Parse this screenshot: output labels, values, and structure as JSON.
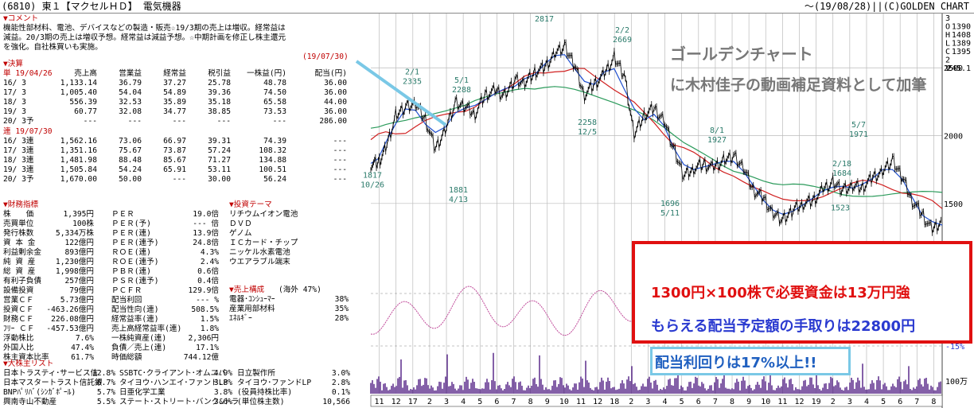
{
  "header": {
    "left": "(6810) 東１【マクセルＨＤ】 電気機器",
    "right": "～(19/08/28)||(C)GOLDEN CHART"
  },
  "comment": {
    "title": "▼コメント",
    "lines": [
      "機能性部材料、電池、デバイスなどの製造・販売☆19/3期の売上は増収。経常益は",
      "減益。20/3期の売上は増収予想。経常益は減益予想。☆中期計画を修正し株主還元",
      "を強化。自社株買いも実施。"
    ],
    "date": "(19/07/30)"
  },
  "kessan": {
    "title": "▼決算",
    "header": [
      "単 19/04/26",
      "売上高",
      "営業益",
      "経常益",
      "税引益",
      "一株益(円)",
      "配当(円)"
    ],
    "rows": [
      [
        "16/ 3",
        "1,133.14",
        "36.79",
        "37.27",
        "25.78",
        "48.78",
        "36.00"
      ],
      [
        "17/ 3",
        "1,005.40",
        "54.04",
        "54.89",
        "39.36",
        "74.50",
        "36.00"
      ],
      [
        "18/ 3",
        "556.39",
        "32.53",
        "35.89",
        "35.18",
        "65.58",
        "44.00"
      ],
      [
        "19/ 3",
        "60.77",
        "32.08",
        "34.77",
        "38.85",
        "73.53",
        "36.00"
      ],
      [
        "20/ 3予",
        "---",
        "---",
        "---",
        "---",
        "---",
        "286.00"
      ]
    ],
    "ren_header": "連 19/07/30",
    "ren_rows": [
      [
        "16/ 3連",
        "1,562.16",
        "73.06",
        "66.97",
        "39.31",
        "74.39",
        "---"
      ],
      [
        "17/ 3連",
        "1,351.16",
        "75.67",
        "73.87",
        "57.24",
        "108.32",
        "---"
      ],
      [
        "18/ 3連",
        "1,481.98",
        "88.48",
        "85.67",
        "71.27",
        "134.88",
        "---"
      ],
      [
        "19/ 3連",
        "1,505.84",
        "54.24",
        "65.91",
        "53.11",
        "100.51",
        "---"
      ],
      [
        "20/ 3予",
        "1,670.00",
        "50.00",
        "---",
        "30.00",
        "56.24",
        "---"
      ]
    ]
  },
  "zaimu": {
    "title": "▼財務指標",
    "rows": [
      [
        "株　　価",
        "1,395円",
        "ＰＥＲ",
        "19.0倍"
      ],
      [
        "売買単位",
        "100株",
        "ＰＥＲ(予)",
        "--- 倍"
      ],
      [
        "発行株数",
        "5,334万株",
        "ＰＥＲ(連)",
        "13.9倍"
      ],
      [
        "資 本 金",
        "122億円",
        "ＰＥＲ(連予)",
        "24.8倍"
      ],
      [
        "利益剰余金",
        "893億円",
        "ＲＯＥ(連)",
        "4.3%"
      ],
      [
        "純 資 産",
        "1,230億円",
        "ＲＯＥ(連予)",
        "2.4%"
      ],
      [
        "総 資 産",
        "1,998億円",
        "ＰＢＲ(連)",
        "0.6倍"
      ],
      [
        "有利子負債",
        "257億円",
        "ＰＳＲ(連予)",
        "0.4倍"
      ],
      [
        "設備投資",
        "79億円",
        "ＰＣＦＲ",
        "129.9倍"
      ],
      [
        "営業ＣＦ",
        "5.73億円",
        "配当利回",
        "--- %"
      ],
      [
        "投資ＣＦ",
        "-463.26億円",
        "配当性向(連)",
        "508.5%"
      ],
      [
        "財務ＣＦ",
        "226.08億円",
        "経常益率(連)",
        "1.5%"
      ],
      [
        "ﾌﾘｰ ＣＦ",
        "-457.53億円",
        "売上高経常益率(連)",
        "1.8%"
      ],
      [
        "浮動株比",
        "7.6%",
        "一株純資産(連)",
        "2,306円"
      ],
      [
        "外国人比",
        "47.4%",
        "負債／売上(連)",
        "17.1%"
      ],
      [
        "株主資本比率",
        "61.7%",
        "時価総額",
        "744.12億"
      ]
    ]
  },
  "theme": {
    "title": "▼投資テーマ",
    "items": [
      "リチウムイオン電池",
      "ＤＶＤ",
      "ゲノム",
      "ＩＣカード・チップ",
      "ニッケル水素電池",
      "ウエアラブル端末"
    ]
  },
  "kosei": {
    "title": "▼売上構成",
    "sub": "(海外 47%)",
    "rows": [
      [
        "電器･ｺﾝｼｭｰﾏｰ",
        "38%"
      ],
      [
        "産業用部材料",
        "35%"
      ],
      [
        "ｴﾈﾙｷﾞｰ",
        "28%"
      ]
    ]
  },
  "kabunushi": {
    "title": "▼大株主リスト",
    "rows": [
      [
        "日本トラスティ･サービス信",
        "12.8%",
        "SSBTC･クライアント･オムニバ",
        "4.9%",
        "日立製作所",
        "3.0%"
      ],
      [
        "日本マスタートラスト信託銀",
        "6.7%",
        "タイヨウ･ハンエイ･ファンドLP",
        "3.8%",
        "タイヨウ･ファンドLP",
        "2.8%"
      ],
      [
        "BNPﾊﾟﾘﾊﾞ(ｼﾝｶﾞﾎﾟｰﾙ)",
        "5.7%",
        "日亜化学工業",
        "3.8%",
        "(役員持株比率)",
        "0.1%"
      ],
      [
        "興南寺山不動産",
        "5.5%",
        "ステート･ストリート･バンク&トラ",
        "3.6%",
        "(単位株主数)",
        "10,566"
      ]
    ]
  },
  "ohlc": {
    "o": "O",
    "h": "H",
    "l": "L",
    "c": "C",
    "ov": "1390",
    "hv": "1408",
    "lv": "1389",
    "cv": "1395",
    "vlabel": "V",
    "vv": "245.1",
    "i1": "3",
    "i2": "2"
  },
  "chart_data": {
    "type": "line",
    "title": "",
    "y_ticks": [
      2500,
      2000,
      1500
    ],
    "ylim": [
      1200,
      2900
    ],
    "osc_labels": [
      "15%",
      "CY",
      "-15%"
    ],
    "vol_label": "100万",
    "x_labels": [
      "11",
      "12",
      "17",
      "2",
      "3",
      "4",
      "5",
      "6",
      "7",
      "8",
      "9",
      "10",
      "11",
      "12",
      "18",
      "2",
      "3",
      "4",
      "5",
      "6",
      "7",
      "8",
      "9",
      "10",
      "11",
      "12",
      "19",
      "2",
      "3",
      "4",
      "5",
      "6",
      "7",
      "8"
    ],
    "price_series": [
      [
        0,
        1790
      ],
      [
        3,
        1800
      ],
      [
        6,
        1900
      ],
      [
        10,
        2150
      ],
      [
        14,
        2210
      ],
      [
        18,
        2230
      ],
      [
        22,
        2120
      ],
      [
        26,
        1900
      ],
      [
        30,
        2050
      ],
      [
        34,
        2240
      ],
      [
        38,
        2210
      ],
      [
        42,
        2160
      ],
      [
        46,
        2300
      ],
      [
        50,
        2330
      ],
      [
        54,
        2300
      ],
      [
        58,
        2410
      ],
      [
        62,
        2380
      ],
      [
        66,
        2470
      ],
      [
        70,
        2500
      ],
      [
        74,
        2610
      ],
      [
        78,
        2660
      ],
      [
        82,
        2520
      ],
      [
        86,
        2300
      ],
      [
        90,
        2380
      ],
      [
        94,
        2450
      ],
      [
        98,
        2580
      ],
      [
        102,
        2450
      ],
      [
        106,
        2000
      ],
      [
        110,
        2150
      ],
      [
        114,
        2200
      ],
      [
        118,
        2120
      ],
      [
        122,
        1900
      ],
      [
        126,
        1700
      ],
      [
        130,
        1760
      ],
      [
        134,
        1790
      ],
      [
        138,
        1760
      ],
      [
        142,
        1820
      ],
      [
        146,
        1850
      ],
      [
        150,
        1760
      ],
      [
        154,
        1600
      ],
      [
        158,
        1540
      ],
      [
        162,
        1430
      ],
      [
        166,
        1380
      ],
      [
        170,
        1450
      ],
      [
        174,
        1500
      ],
      [
        178,
        1520
      ],
      [
        182,
        1600
      ],
      [
        186,
        1660
      ],
      [
        190,
        1600
      ],
      [
        194,
        1620
      ],
      [
        198,
        1620
      ],
      [
        202,
        1690
      ],
      [
        206,
        1740
      ],
      [
        210,
        1820
      ],
      [
        214,
        1690
      ],
      [
        218,
        1520
      ],
      [
        222,
        1420
      ],
      [
        226,
        1300
      ],
      [
        230,
        1380
      ]
    ],
    "peaks": [
      {
        "d": "2/1",
        "v": "2335"
      },
      {
        "d": "5/1",
        "v": "2288"
      },
      {
        "d": "10/25",
        "v": "2817"
      },
      {
        "d": "2/2",
        "v": "2669"
      },
      {
        "d": "8/1",
        "v": "1927"
      },
      {
        "d": "2/18",
        "v": "1684"
      },
      {
        "d": "5/7",
        "v": "1971"
      }
    ],
    "troughs": [
      {
        "d": "10/26",
        "v": "1817"
      },
      {
        "d": "4/13",
        "v": "1881"
      },
      {
        "d": "12/5",
        "v": "2258"
      },
      {
        "d": "5/11",
        "v": "1696"
      },
      {
        "d": "12/25",
        "v": "1310"
      },
      {
        "d": "8/6",
        "v": "1273"
      },
      {
        "d": "",
        "v": "1523"
      }
    ]
  },
  "overlay": {
    "title1": "ゴールデンチャート",
    "title2": "に木村佳子の動画補足資料として加筆",
    "box_line1": "1300円×100株で必要資金は13万円強",
    "box_line2": "もらえる配当予定額の手取りは22800円",
    "box_line3": "配当利回りは17%以上!!"
  },
  "colors": {
    "accent_red": "#c00000",
    "price": "#000000",
    "ma_short": "#1f4fd0",
    "ma_mid": "#d02020",
    "ma_long": "#2a9a5a",
    "volume": "#5a2a8a",
    "box_border": "#e01010",
    "box2_border": "#7ac8e6",
    "line1_color": "#e01010",
    "line2_color": "#2a3ad0",
    "line3_color": "#2060c0"
  }
}
